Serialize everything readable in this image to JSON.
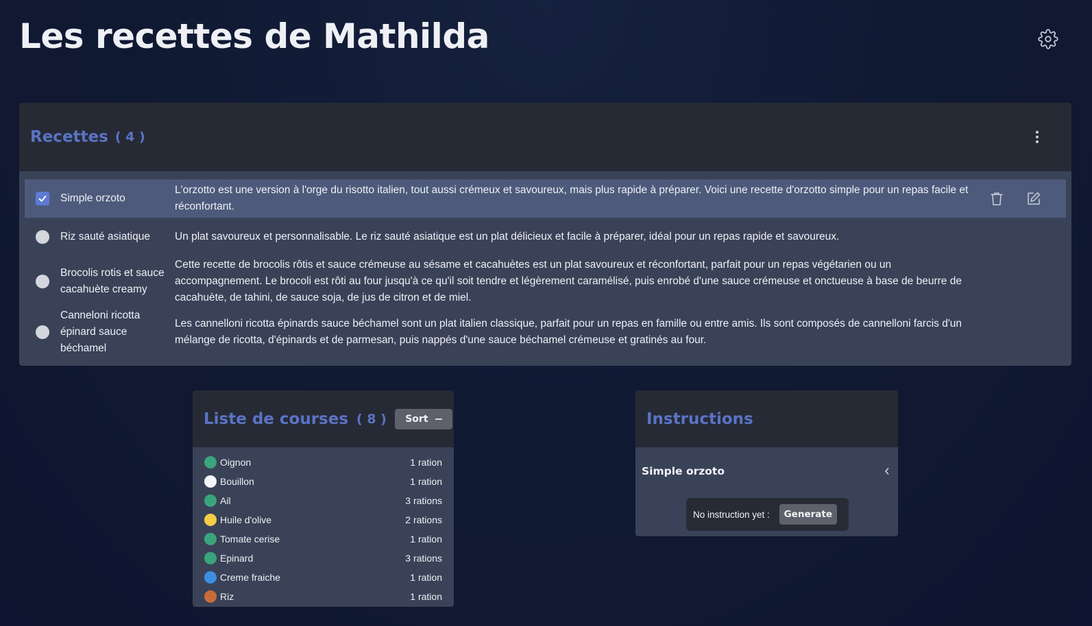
{
  "app": {
    "title": "Les recettes de Mathilda",
    "settings_icon": "gear-icon"
  },
  "recipes": {
    "title": "Recettes",
    "count": "( 4 )",
    "items": [
      {
        "name": "Simple orzoto",
        "description": "L'orzotto est une version à l'orge du risotto italien, tout aussi crémeux et savoureux, mais plus rapide à préparer. Voici une recette d'orzotto simple pour un repas facile et réconfortant.",
        "selected": true
      },
      {
        "name": "Riz sauté asiatique",
        "description": "Un plat savoureux et personnalisable. Le riz sauté asiatique est un plat délicieux et facile à préparer, idéal pour un repas rapide et savoureux.",
        "selected": false
      },
      {
        "name": "Brocolis rotis et sauce cacahuète creamy",
        "description": "Cette recette de brocolis rôtis et sauce crémeuse au sésame et cacahuètes est un plat savoureux et réconfortant, parfait pour un repas végétarien ou un accompagnement. Le brocoli est rôti au four jusqu'à ce qu'il soit tendre et légèrement caramélisé, puis enrobé d'une sauce crémeuse et onctueuse à base de beurre de cacahuète, de tahini, de sauce soja, de jus de citron et de miel.",
        "selected": false
      },
      {
        "name": "Canneloni ricotta épinard sauce béchamel",
        "description": "Les cannelloni ricotta épinards sauce béchamel sont un plat italien classique, parfait pour un repas en famille ou entre amis. Ils sont composés de cannelloni farcis d'un mélange de ricotta, d'épinards et de parmesan, puis nappés d'une sauce béchamel crémeuse et gratinés au four.",
        "selected": false
      }
    ]
  },
  "shopping": {
    "title": "Liste de courses",
    "count": "( 8 )",
    "sort_label": "Sort",
    "items": [
      {
        "name": "Oignon",
        "qty": "1 ration",
        "color": "#3aa57a"
      },
      {
        "name": "Bouillon",
        "qty": "1 ration",
        "color": "#f4f5f7"
      },
      {
        "name": "Ail",
        "qty": "3 rations",
        "color": "#3aa57a"
      },
      {
        "name": "Huile d'olive",
        "qty": "2 rations",
        "color": "#f3cd45"
      },
      {
        "name": "Tomate cerise",
        "qty": "1 ration",
        "color": "#3aa57a"
      },
      {
        "name": "Epinard",
        "qty": "3 rations",
        "color": "#3aa57a"
      },
      {
        "name": "Creme fraiche",
        "qty": "1 ration",
        "color": "#3d8ee0"
      },
      {
        "name": "Riz",
        "qty": "1 ration",
        "color": "#c96b3a"
      }
    ]
  },
  "instructions": {
    "title": "Instructions",
    "recipe": "Simple orzoto",
    "empty_message": "No instruction yet :",
    "generate_label": "Generate"
  },
  "colors": {
    "accent": "#5a73c4",
    "panel": "#3a4258",
    "panel_header": "#262a35",
    "selected_row": "#4d5a7b"
  }
}
